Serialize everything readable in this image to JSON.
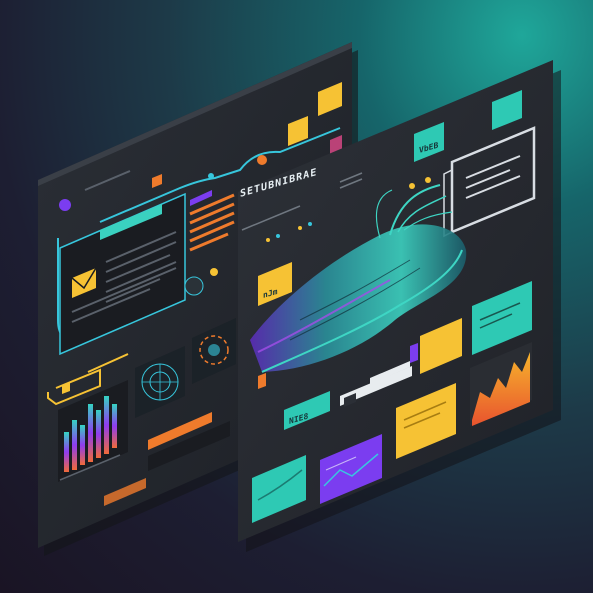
{
  "hero": {
    "title": "SETUBNIBRAE"
  },
  "badges": {
    "cta_a": "nJm",
    "cta_b": "VbEB",
    "cta_c": "NIE8"
  },
  "colors": {
    "teal": "#2ec9b4",
    "yellow": "#f6c234",
    "orange": "#ef7b2c",
    "purple": "#7b3df0",
    "panel": "#24262c"
  },
  "icons": [
    "mail-icon",
    "radar-icon",
    "bar-chart-icon",
    "area-chart-icon",
    "swoosh-graphic"
  ]
}
